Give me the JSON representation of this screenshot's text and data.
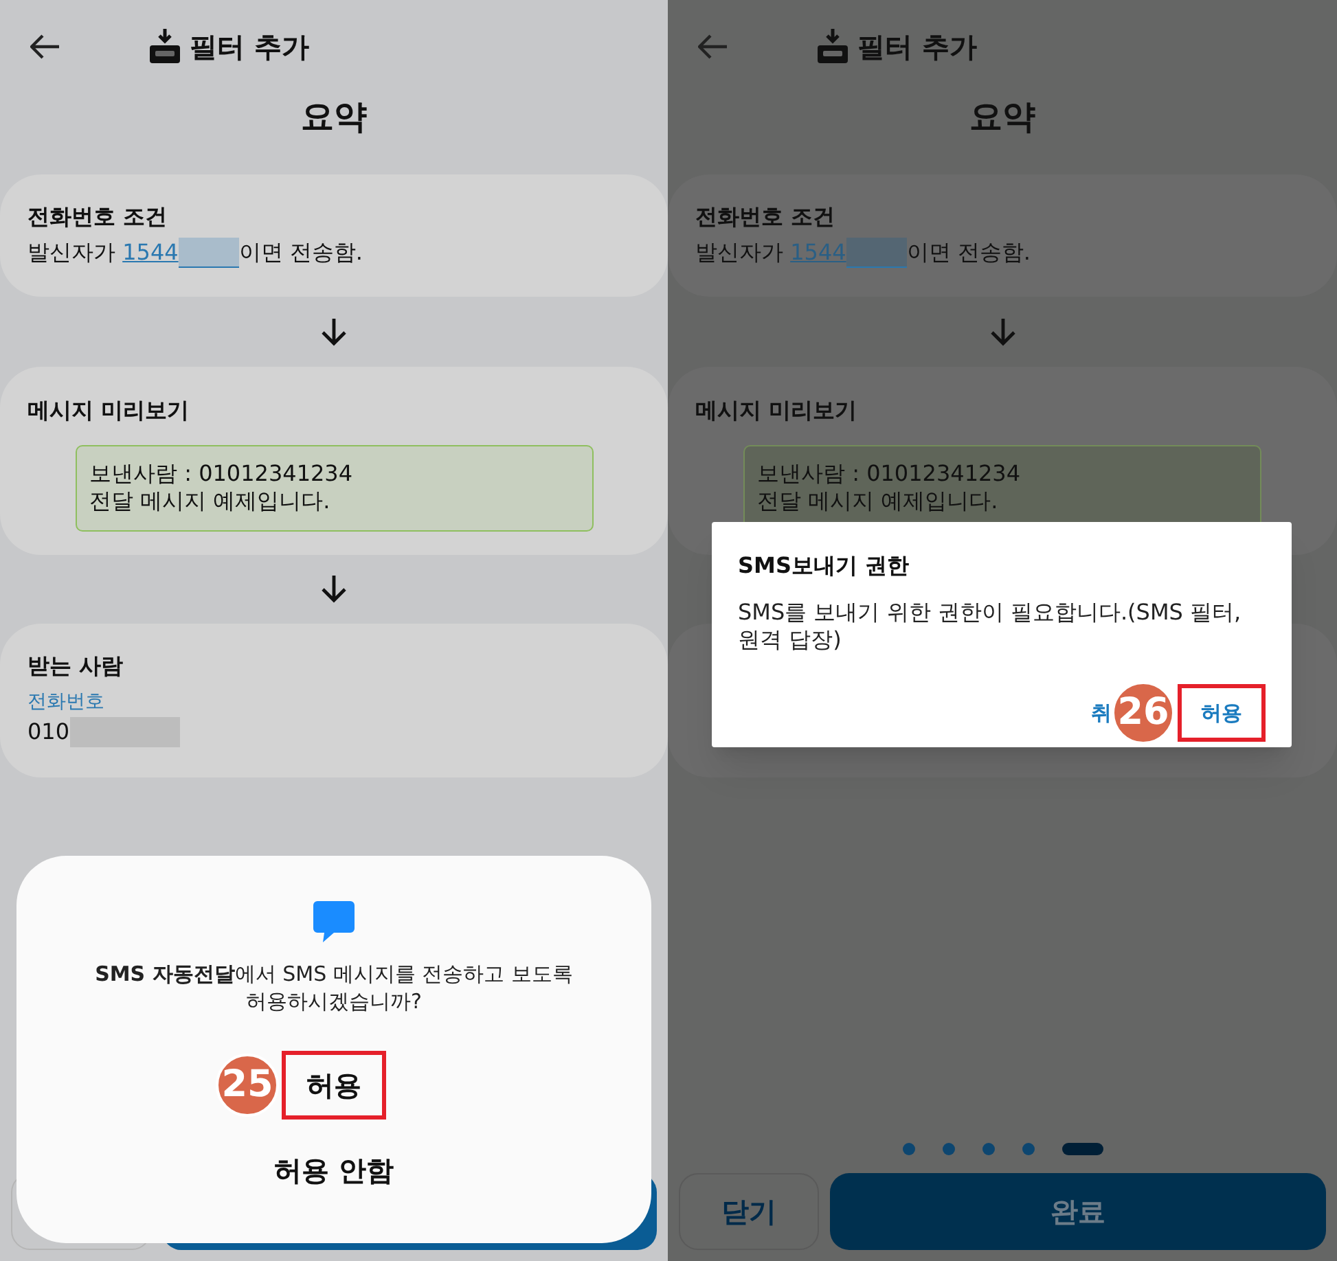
{
  "screens": [
    {
      "dimmed": false,
      "header": {
        "title": "필터 추가"
      },
      "heading": "요약",
      "condition": {
        "title": "전화번호 조건",
        "prefix": "발신자가 ",
        "number": "1544",
        "suffix": "이면 전송함."
      },
      "preview": {
        "title": "메시지 미리보기",
        "lines": [
          "보낸사람 : 01012341234",
          "전달 메시지 예제입니다."
        ]
      },
      "recipient": {
        "title": "받는 사람",
        "label": "전화번호",
        "value": "010"
      },
      "dialog": {
        "kind": "sheet",
        "message": "**SMS 자동전달**에서 SMS 메시지를 전송하고 보도록 허용하시겠습니까?",
        "allow": "허용",
        "deny": "허용 안함",
        "step": "25"
      }
    },
    {
      "dimmed": true,
      "header": {
        "title": "필터 추가"
      },
      "heading": "요약",
      "condition": {
        "title": "전화번호 조건",
        "prefix": "발신자가 ",
        "number": "1544",
        "suffix": "이면 전송함."
      },
      "preview": {
        "title": "메시지 미리보기",
        "lines": [
          "보낸사람 : 01012341234",
          "전달 메시지 예제입니다."
        ]
      },
      "dialog": {
        "kind": "alert",
        "title": "SMS보내기 권한",
        "message": "SMS를 보내기 위한 권한이 필요합니다.(SMS 필터, 원격 답장)",
        "cancel": "취",
        "allow": "허용",
        "step": "26"
      },
      "pager": [
        {
          "selected": false
        },
        {
          "selected": false
        },
        {
          "selected": false
        },
        {
          "selected": false
        },
        {
          "selected": true
        }
      ],
      "footer": {
        "close": "닫기",
        "done": "완료"
      }
    }
  ]
}
